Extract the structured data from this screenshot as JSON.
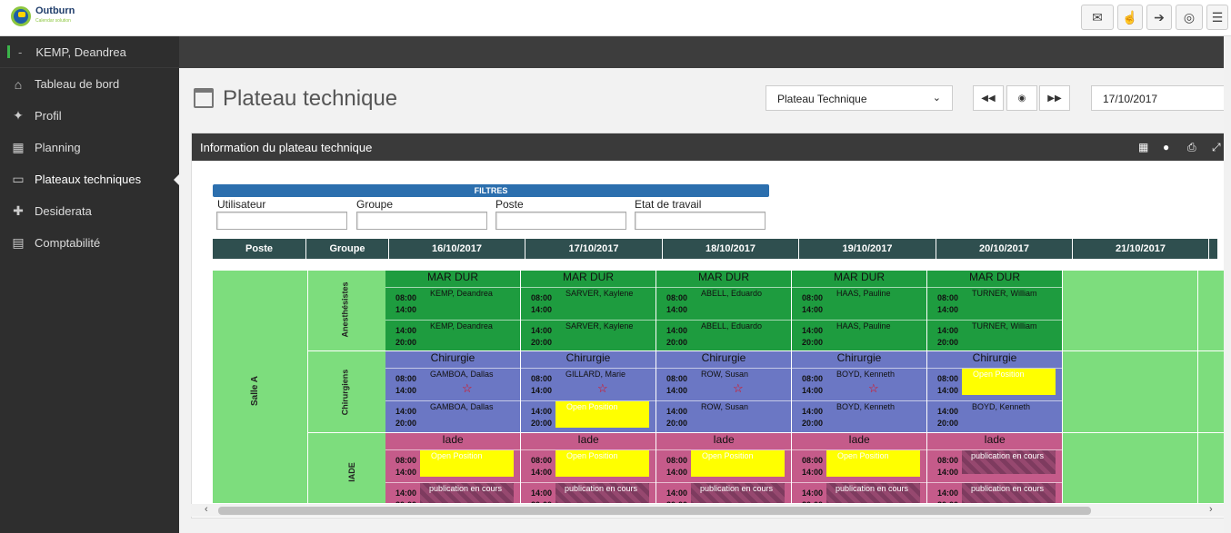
{
  "app": {
    "name": "Outburn",
    "tagline": "Calendar solution"
  },
  "toolbar": {
    "icons": [
      "envelope-icon",
      "hand-icon",
      "logout-icon",
      "eye-slash-icon",
      "menu-icon"
    ]
  },
  "user": {
    "dash": "-",
    "name": "KEMP, Deandrea"
  },
  "sidebar": {
    "items": [
      {
        "label": "Tableau de bord",
        "icon": "home-icon"
      },
      {
        "label": "Profil",
        "icon": "person-icon"
      },
      {
        "label": "Planning",
        "icon": "calendar-icon"
      },
      {
        "label": "Plateaux techniques",
        "icon": "monitor-icon"
      },
      {
        "label": "Desiderata",
        "icon": "puzzle-icon"
      },
      {
        "label": "Comptabilité",
        "icon": "book-icon"
      }
    ]
  },
  "page": {
    "title": "Plateau technique"
  },
  "controls": {
    "site": "Plateau Technique",
    "date": "17/10/2017"
  },
  "panel": {
    "title": "Information du plateau technique"
  },
  "filters": {
    "title": "FILTRES",
    "labels": [
      "Utilisateur",
      "Groupe",
      "Poste",
      "Etat de travail"
    ]
  },
  "table": {
    "headers": [
      "Poste",
      "Groupe",
      "16/10/2017",
      "17/10/2017",
      "18/10/2017",
      "19/10/2017",
      "20/10/2017",
      "21/10/2017"
    ],
    "salle": "Salle A",
    "groups": [
      "Anesthésistes",
      "Chirurgiens",
      "IADE"
    ],
    "categories": [
      "MAR DUR",
      "Chirurgie",
      "Iade"
    ],
    "times": {
      "a1": "08:00",
      "a2": "14:00",
      "b1": "14:00",
      "b2": "20:00"
    },
    "anes": [
      [
        "KEMP, Deandrea",
        "KEMP, Deandrea"
      ],
      [
        "SARVER, Kaylene",
        "SARVER, Kaylene"
      ],
      [
        "ABELL, Eduardo",
        "ABELL, Eduardo"
      ],
      [
        "HAAS, Pauline",
        "HAAS, Pauline"
      ],
      [
        "TURNER, William",
        "TURNER, William"
      ]
    ],
    "chir": [
      [
        "GAMBOA, Dallas",
        "GAMBOA, Dallas"
      ],
      [
        "GILLARD, Marie",
        "Open Position"
      ],
      [
        "ROW, Susan",
        "ROW, Susan"
      ],
      [
        "BOYD, Kenneth",
        "BOYD, Kenneth"
      ],
      [
        "Open Position",
        "BOYD, Kenneth"
      ]
    ],
    "iade": [
      [
        "Open Position",
        "publication en cours"
      ],
      [
        "Open Position",
        "publication en cours"
      ],
      [
        "Open Position",
        "publication en cours"
      ],
      [
        "Open Position",
        "publication en cours"
      ],
      [
        "publication en cours",
        "publication en cours"
      ]
    ],
    "star": "☆"
  }
}
